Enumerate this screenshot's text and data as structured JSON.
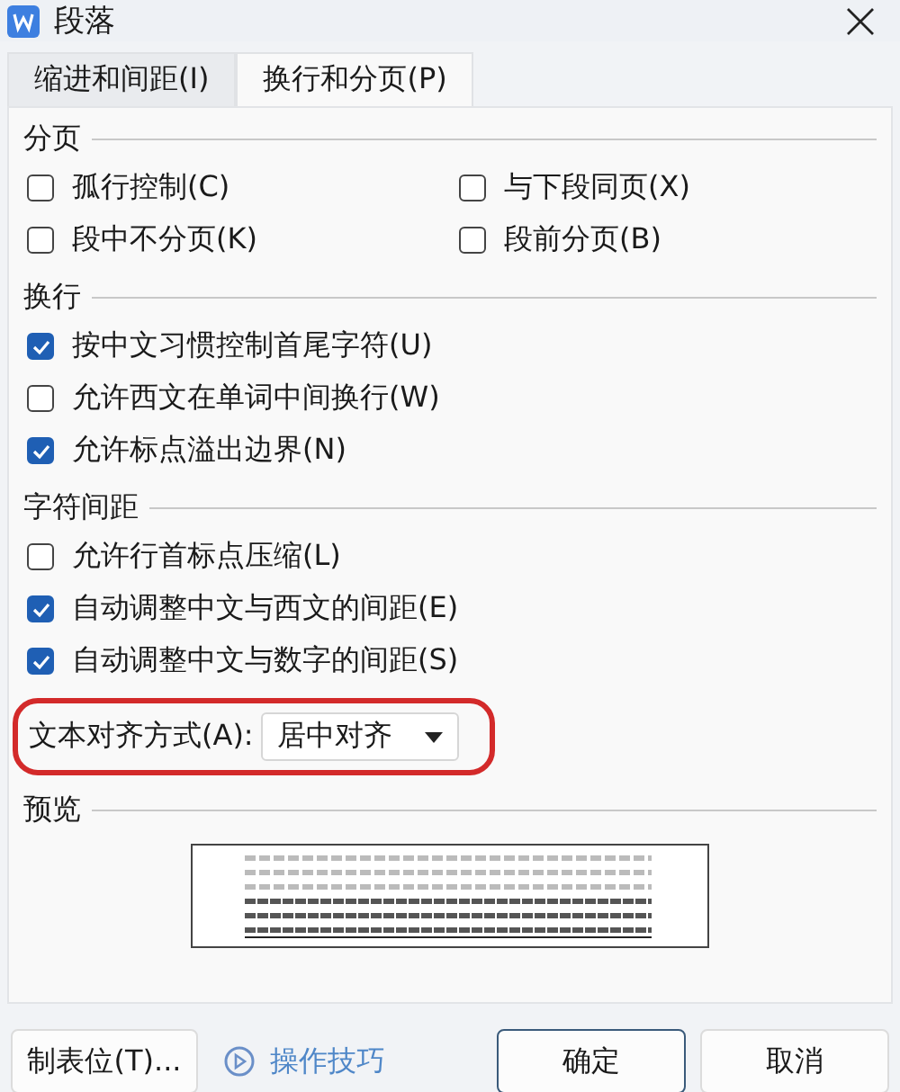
{
  "window": {
    "title": "段落"
  },
  "tabs": [
    {
      "label": "缩进和间距(I)",
      "selected": false
    },
    {
      "label": "换行和分页(P)",
      "selected": true
    }
  ],
  "sections": [
    {
      "title": "分页",
      "kind": "grid",
      "items": [
        {
          "label": "孤行控制(C)",
          "checked": false
        },
        {
          "label": "与下段同页(X)",
          "checked": false
        },
        {
          "label": "段中不分页(K)",
          "checked": false
        },
        {
          "label": "段前分页(B)",
          "checked": false
        }
      ]
    },
    {
      "title": "换行",
      "kind": "list",
      "items": [
        {
          "label": "按中文习惯控制首尾字符(U)",
          "checked": true
        },
        {
          "label": "允许西文在单词中间换行(W)",
          "checked": false
        },
        {
          "label": "允许标点溢出边界(N)",
          "checked": true
        }
      ]
    },
    {
      "title": "字符间距",
      "kind": "list",
      "items": [
        {
          "label": "允许行首标点压缩(L)",
          "checked": false
        },
        {
          "label": "自动调整中文与西文的间距(E)",
          "checked": true
        },
        {
          "label": "自动调整中文与数字的间距(S)",
          "checked": true
        }
      ]
    }
  ],
  "alignment": {
    "label": "文本对齐方式(A):",
    "value": "居中对齐",
    "highlighted": true
  },
  "preview": {
    "title": "预览"
  },
  "footer": {
    "tabs_button": "制表位(T)...",
    "tips_link": "操作技巧",
    "ok": "确定",
    "cancel": "取消"
  }
}
